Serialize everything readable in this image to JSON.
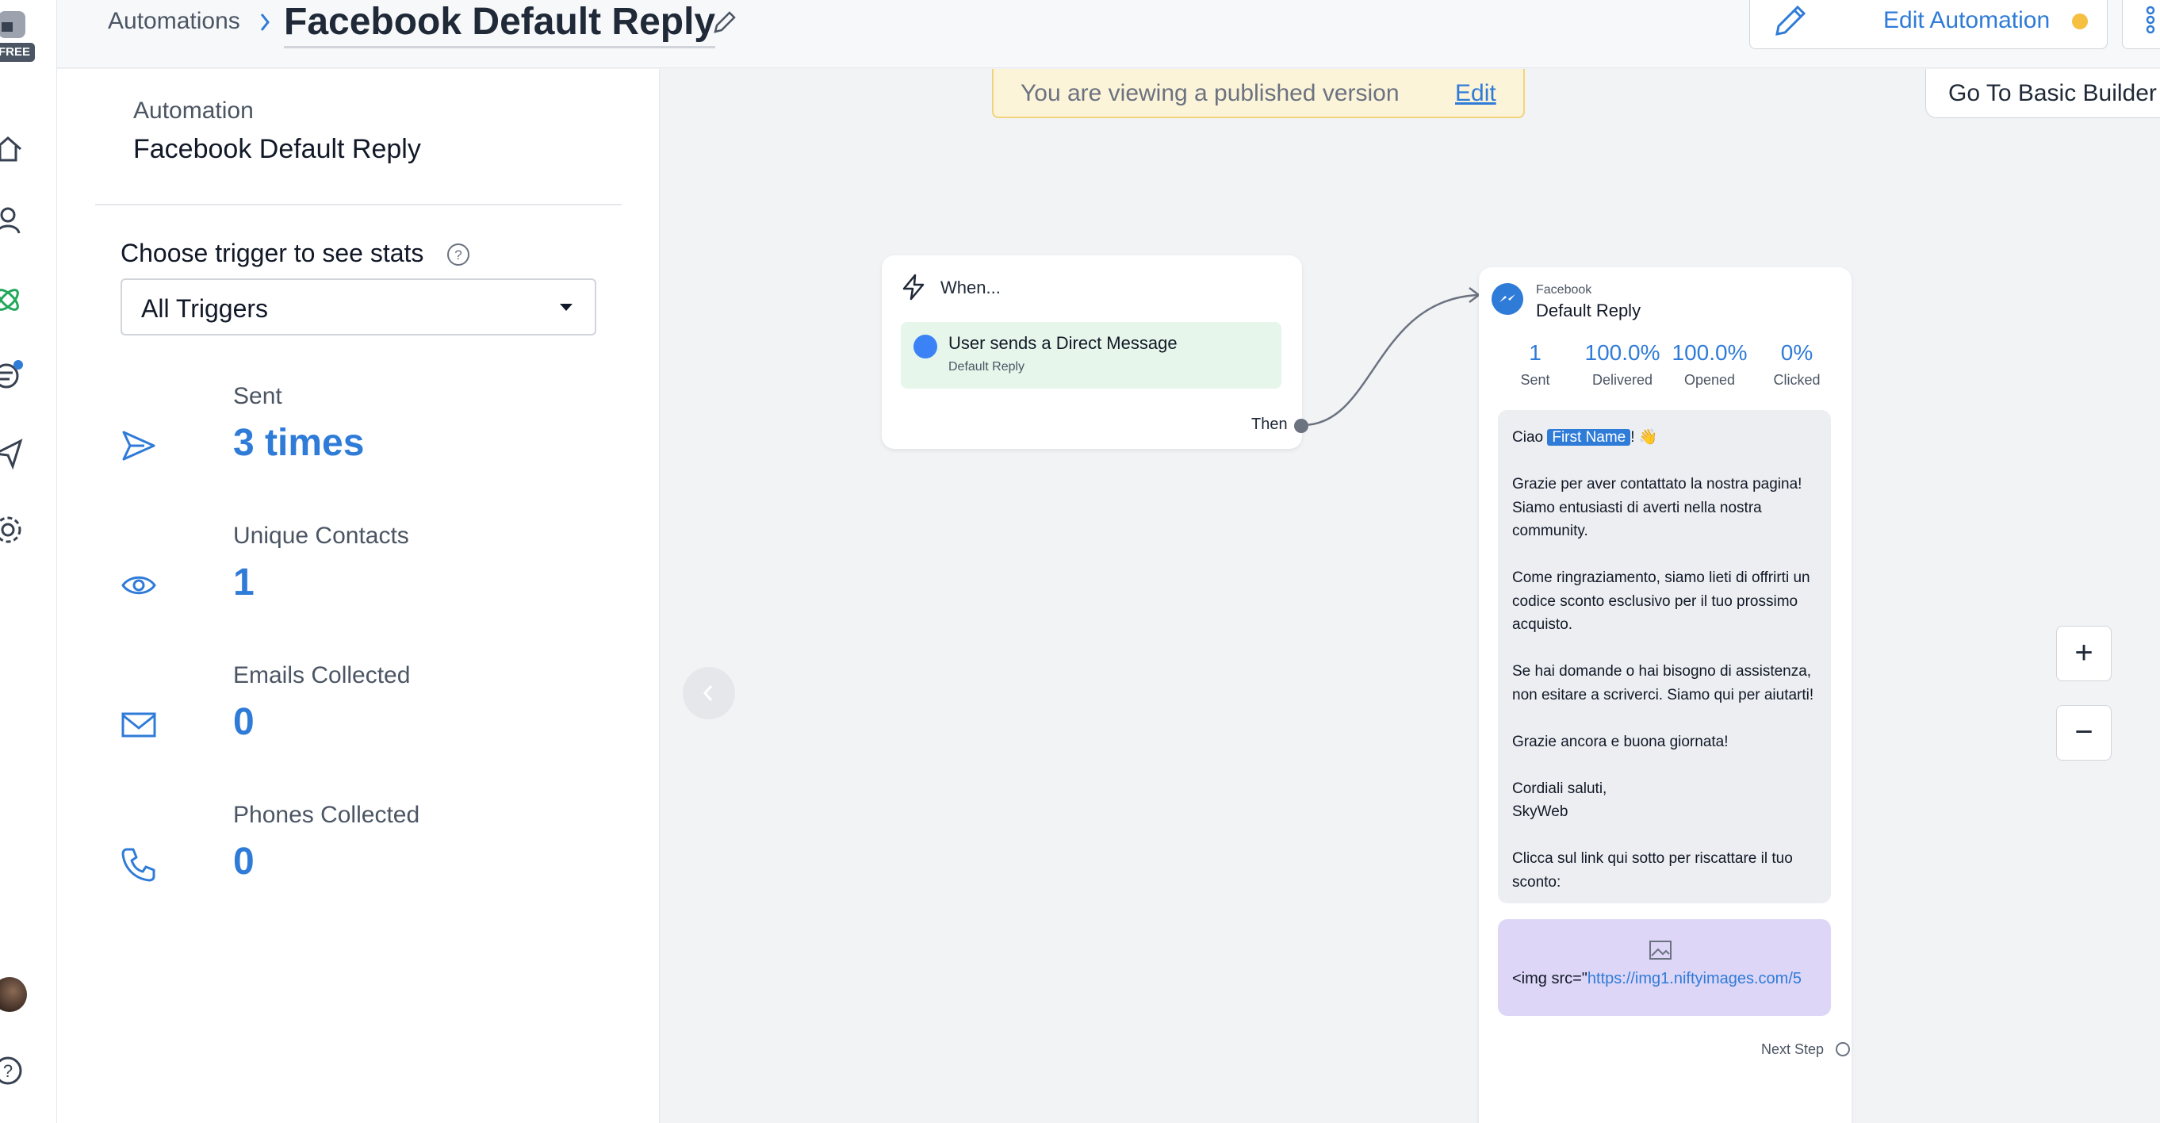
{
  "rail": {
    "badge": "FREE",
    "icons": [
      "home-icon",
      "user-icon",
      "atom-icon",
      "chat-icon",
      "send-icon",
      "gear-icon",
      "help-icon"
    ]
  },
  "header": {
    "breadcrumb": "Automations",
    "title": "Facebook Default Reply",
    "edit_automation_label": "Edit Automation",
    "status_dot_color": "#f5c042"
  },
  "banner": {
    "text": "You are viewing a published version",
    "link": "Edit"
  },
  "basic_builder_label": "Go To Basic Builder",
  "sidebar": {
    "automation_label": "Automation",
    "automation_name": "Facebook Default Reply",
    "trigger_prompt": "Choose trigger to see stats",
    "trigger_select_value": "All Triggers",
    "stats": [
      {
        "label": "Sent",
        "value": "3 times",
        "icon": "send-icon"
      },
      {
        "label": "Unique Contacts",
        "value": "1",
        "icon": "eye-icon"
      },
      {
        "label": "Emails Collected",
        "value": "0",
        "icon": "mail-icon"
      },
      {
        "label": "Phones Collected",
        "value": "0",
        "icon": "phone-icon"
      }
    ]
  },
  "trigger_node": {
    "heading": "When...",
    "trigger_title": "User sends a Direct Message",
    "trigger_subtitle": "Default Reply",
    "then_label": "Then"
  },
  "reply_node": {
    "source": "Facebook",
    "name": "Default Reply",
    "stats": [
      {
        "value": "1",
        "label": "Sent"
      },
      {
        "value": "100.0%",
        "label": "Delivered"
      },
      {
        "value": "100.0%",
        "label": "Opened"
      },
      {
        "value": "0%",
        "label": "Clicked"
      }
    ],
    "message": {
      "greeting_prefix": "Ciao ",
      "first_name_tag": "First Name",
      "greeting_suffix": "! 👋",
      "p1": "Grazie per aver contattato la nostra pagina! Siamo entusiasti di averti nella nostra community.",
      "p2": "Come ringraziamento, siamo lieti di offrirti un codice sconto esclusivo per il tuo prossimo acquisto.",
      "p3": "Se hai domande o hai bisogno di assistenza, non esitare a scriverci. Siamo qui per aiutarti!",
      "p4": "Grazie ancora e buona giornata!",
      "p5a": "Cordiali saluti,",
      "p5b": "SkyWeb",
      "p6": "Clicca sul link qui sotto per riscattare il tuo sconto:"
    },
    "image_code_prefix": "<img src=\"",
    "image_code_url": "https://img1.niftyimages.com/5",
    "next_step_label": "Next Step"
  },
  "zoom": {
    "in": "+",
    "out": "−"
  }
}
